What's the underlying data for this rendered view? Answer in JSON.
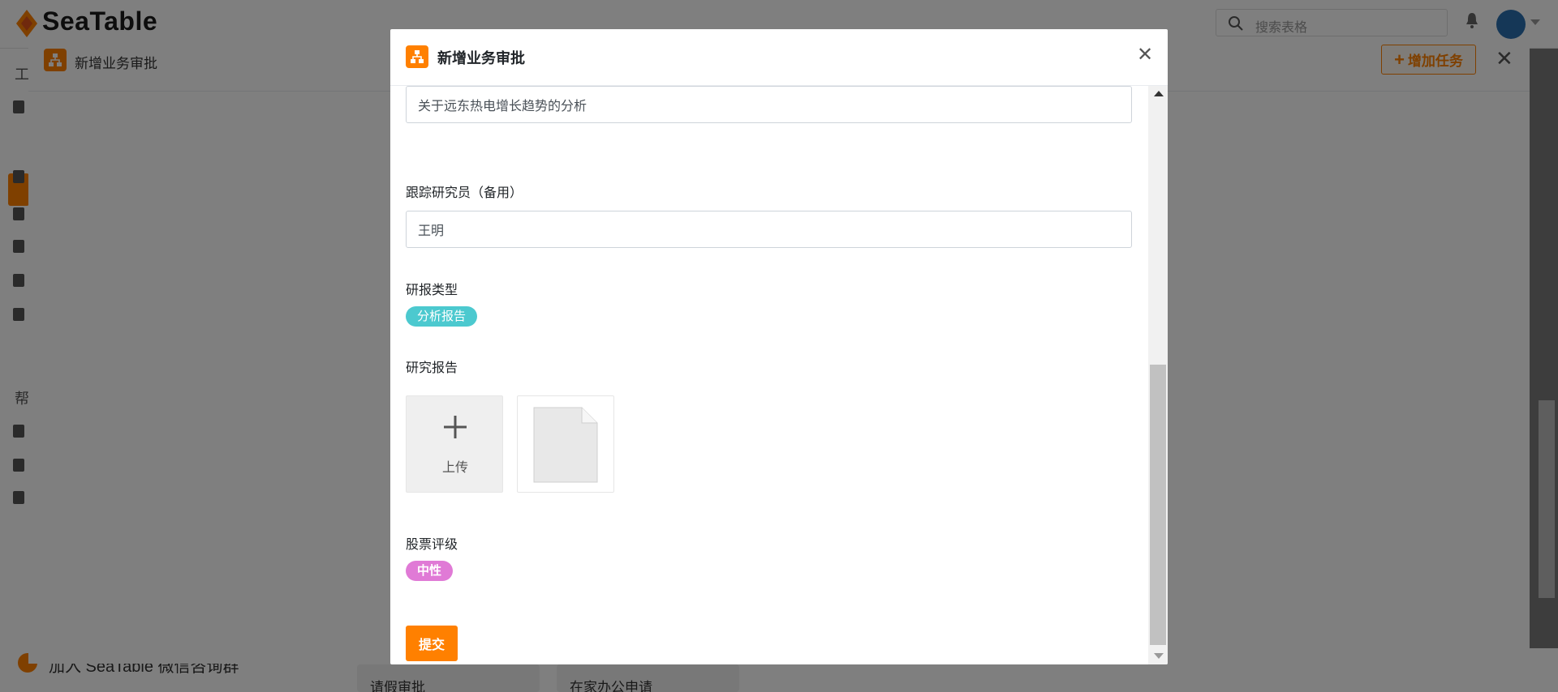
{
  "app": {
    "logo_text": "SeaTable",
    "search_placeholder": "搜索表格",
    "sidebar_section_1": "工",
    "sidebar_section_2": "帮",
    "bottom_link": "加入 SeaTable 微信咨询群",
    "bottom_cards": [
      "请假审批",
      "在家办公申请"
    ]
  },
  "panel": {
    "title": "新增业务审批",
    "add_task_label": "增加任务",
    "add_task_icon": "plus-icon",
    "close_icon": "close-icon"
  },
  "modal": {
    "title": "新增业务审批",
    "close_icon": "close-icon",
    "fields": {
      "title_value": "关于远东热电增长趋势的分析",
      "backup_researcher_label": "跟踪研究员（备用）",
      "backup_researcher_value": "王明",
      "report_type_label": "研报类型",
      "report_type_tag": "分析报告",
      "report_label": "研究报告",
      "upload_label": "上传",
      "rating_label": "股票评级",
      "rating_tag": "中性"
    },
    "submit_label": "提交"
  },
  "colors": {
    "accent": "#ff8000",
    "report_type_tag": "#4cc9cf",
    "rating_tag": "#e07ad6"
  }
}
